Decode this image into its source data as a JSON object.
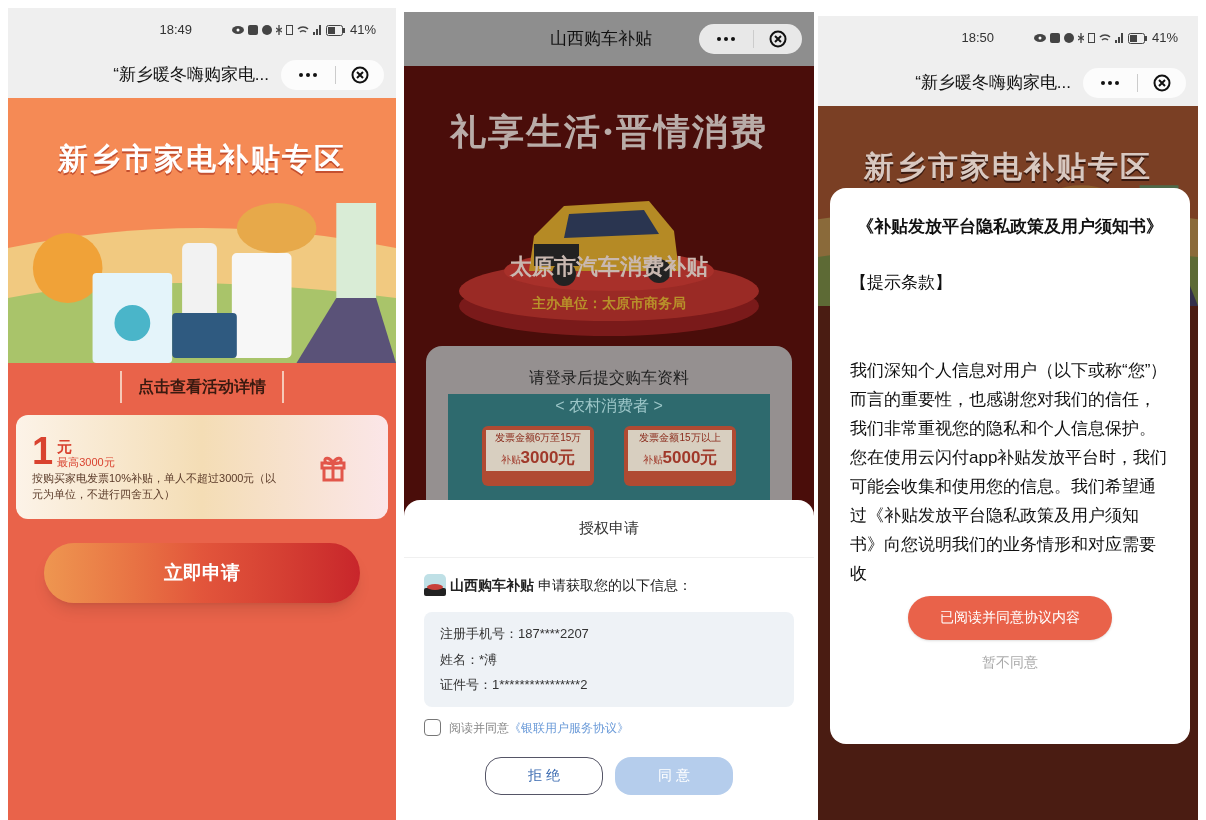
{
  "panels": [
    {
      "kind": "home",
      "status_bar": {
        "time": "18:49",
        "battery": "41%"
      },
      "nav_bar": {
        "title": "“新乡暖冬嗨购家电..."
      },
      "banner": {
        "title": "新乡市家电补贴专区"
      },
      "details_link": "点击查看活动详情",
      "coupon": {
        "amount": "1",
        "unit": "元",
        "cap": "最高3000元",
        "description": "按购买家电发票10%补贴，单人不超过3000元（以元为单位，不进行四舍五入）"
      },
      "apply_button": "立即申请"
    },
    {
      "kind": "auth",
      "nav_bar": {
        "title": "山西购车补贴"
      },
      "banner": {
        "slogan": "礼享生活·晋情消费",
        "title": "太原市汽车消费补贴",
        "organizer": "主办单位：太原市商务局"
      },
      "login_card": {
        "title": "请登录后提交购车资料",
        "tab": "< 农村消费者 >",
        "offers": [
          {
            "condition": "发票金额6万至15万",
            "prefix": "补贴",
            "amount": "3000元"
          },
          {
            "condition": "发票金额15万以上",
            "prefix": "补贴",
            "amount": "5000元"
          }
        ]
      },
      "auth_sheet": {
        "title": "授权申请",
        "app_name": "山西购车补贴",
        "request": "申请获取您的以下信息：",
        "fields": [
          "注册手机号：187****2207",
          "姓名：*溥",
          "证件号：1****************2"
        ],
        "agreement": {
          "checked": false,
          "text": "阅读并同意",
          "link": "《银联用户服务协议》"
        },
        "reject_button": "拒 绝",
        "agree_button": {
          "label": "同 意",
          "disabled": true
        }
      }
    },
    {
      "kind": "privacy",
      "status_bar": {
        "time": "18:50",
        "battery": "41%"
      },
      "nav_bar": {
        "title": "“新乡暖冬嗨购家电..."
      },
      "banner": {
        "title": "新乡市家电补贴专区"
      },
      "dialog": {
        "title": "《补贴发放平台隐私政策及用户须知书》",
        "heading": "【提示条款】",
        "body": "我们深知个人信息对用户（以下或称“您”）而言的重要性，也感谢您对我们的信任，我们非常重视您的隐私和个人信息保护。您在使用云闪付app补贴发放平台时，我们可能会收集和使用您的信息。我们希望通过《补贴发放平台隐私政策及用户须知书》向您说明我们的业务情形和对应需要收",
        "accept_button": "已阅读并同意协议内容",
        "decline_button": "暂不同意"
      }
    }
  ]
}
